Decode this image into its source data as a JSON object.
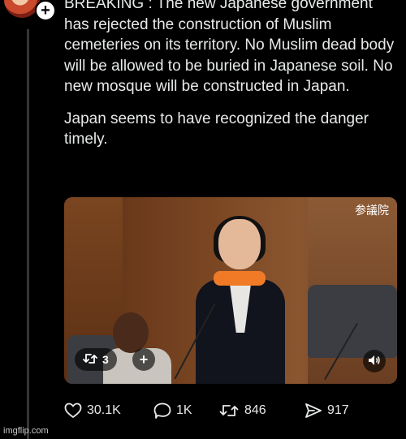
{
  "tweet": {
    "paragraph_1": "BREAKING : The new Japanese government has rejected the construction of Muslim cemeteries on its territory. No Muslim dead body will be allowed to be buried in Japanese soil. No new mosque will be constructed in Japan.",
    "paragraph_2": "Japan seems to have recognized the danger timely."
  },
  "media": {
    "watermark": "参議院",
    "media_count": "3",
    "add_symbol": "+"
  },
  "actions": {
    "likes": "30.1K",
    "replies": "1K",
    "reposts": "846",
    "shares": "917"
  },
  "footer": {
    "imgflip": "imgflip.com"
  },
  "icons": {
    "follow": "plus-icon",
    "like": "heart-icon",
    "reply": "reply-icon",
    "repost": "repost-icon",
    "share": "share-icon",
    "sound": "speaker-icon"
  },
  "colors": {
    "background": "#000000",
    "text": "#e7e9ea",
    "scarf_accent": "#f07a26"
  }
}
